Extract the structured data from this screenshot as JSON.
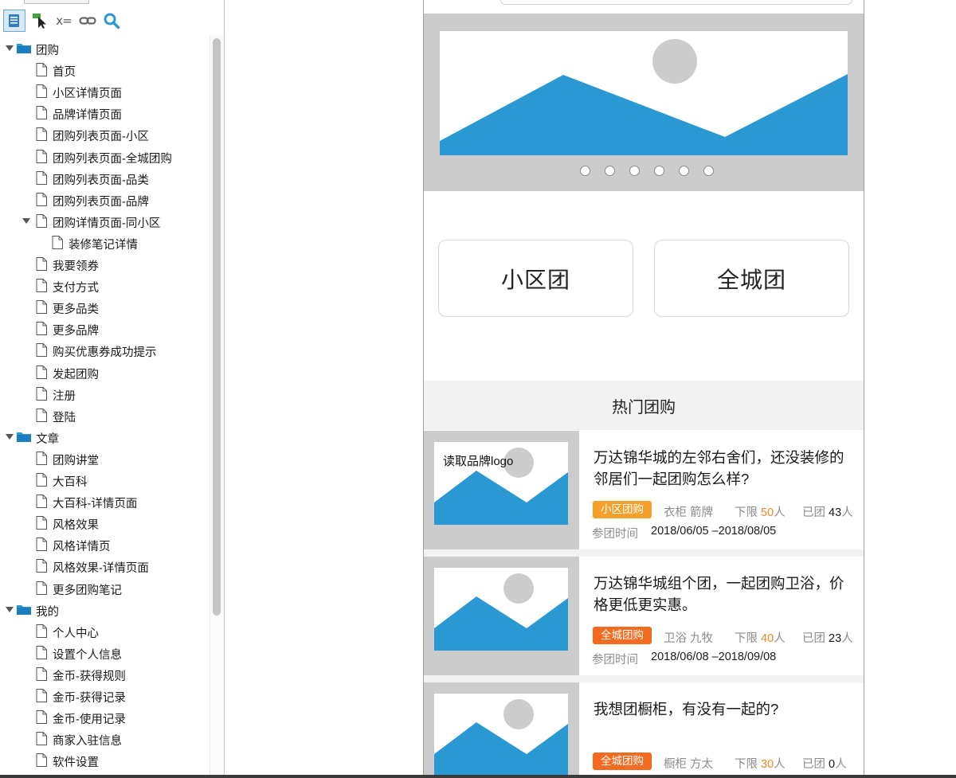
{
  "toolbar": {
    "icons": [
      "pages-view-icon",
      "select-pointer-icon",
      "variables-icon",
      "link-icon",
      "search-icon"
    ],
    "variables_label": "x="
  },
  "tree": {
    "folders": [
      {
        "label": "团购",
        "items": [
          {
            "label": "首页"
          },
          {
            "label": "小区详情页面"
          },
          {
            "label": "品牌详情页面"
          },
          {
            "label": "团购列表页面-小区"
          },
          {
            "label": "团购列表页面-全城团购"
          },
          {
            "label": "团购列表页面-品类"
          },
          {
            "label": "团购列表页面-品牌"
          },
          {
            "label": "团购详情页面-同小区",
            "children": [
              {
                "label": "装修笔记详情"
              }
            ]
          },
          {
            "label": "我要领券"
          },
          {
            "label": "支付方式"
          },
          {
            "label": "更多品类"
          },
          {
            "label": "更多品牌"
          },
          {
            "label": "购买优惠券成功提示"
          },
          {
            "label": "发起团购"
          },
          {
            "label": "注册"
          },
          {
            "label": "登陆"
          }
        ]
      },
      {
        "label": "文章",
        "items": [
          {
            "label": "团购讲堂"
          },
          {
            "label": "大百科"
          },
          {
            "label": "大百科-详情页面"
          },
          {
            "label": "风格效果"
          },
          {
            "label": "风格详情页"
          },
          {
            "label": "风格效果-详情页面"
          },
          {
            "label": "更多团购笔记"
          }
        ]
      },
      {
        "label": "我的",
        "items": [
          {
            "label": "个人中心"
          },
          {
            "label": "设置个人信息"
          },
          {
            "label": "金币-获得规则"
          },
          {
            "label": "金币-获得记录"
          },
          {
            "label": "金币-使用记录"
          },
          {
            "label": "商家入驻信息"
          },
          {
            "label": "软件设置"
          }
        ]
      }
    ]
  },
  "phone": {
    "banner": {
      "dot_count": 6,
      "active_dot": null
    },
    "categories": {
      "left": "小区团",
      "right": "全城团"
    },
    "hot_section_title": "热门团购",
    "cards": [
      {
        "logo_text": "读取品牌logo",
        "title": "万达锦华城的左邻右舍们，还没装修的邻居们一起团购怎么样?",
        "tag": "小区团购",
        "tag_color": "#f5a02a",
        "cats": "衣柜 箭牌",
        "limit_prefix": "下限",
        "limit_num": "50",
        "limit_unit": "人",
        "joined_prefix": "已团",
        "joined_num": "43",
        "joined_unit": "人",
        "time_label": "参团时间",
        "time_value": "2018/06/05 –2018/08/05"
      },
      {
        "logo_text": "",
        "title": "万达锦华城组个团，一起团购卫浴，价格更低更实惠。",
        "tag": "全城团购",
        "tag_color": "#f26b21",
        "cats": "卫浴 九牧",
        "limit_prefix": "下限",
        "limit_num": "40",
        "limit_unit": "人",
        "joined_prefix": "已团",
        "joined_num": "23",
        "joined_unit": "人",
        "time_label": "参团时间",
        "time_value": "2018/06/08 –2018/09/08"
      },
      {
        "logo_text": "",
        "title": "我想团橱柜，有没有一起的?",
        "tag": "全城团购",
        "tag_color": "#f26b21",
        "cats": "橱柜 方太",
        "limit_prefix": "下限",
        "limit_num": "30",
        "limit_unit": "人",
        "joined_prefix": "已团",
        "joined_num": "0",
        "joined_unit": "人",
        "time_label": "",
        "time_value": ""
      }
    ]
  },
  "colors": {
    "accent_blue": "#2a98d3",
    "placeholder_gray": "#cccccc",
    "orange": "#f0892b"
  }
}
